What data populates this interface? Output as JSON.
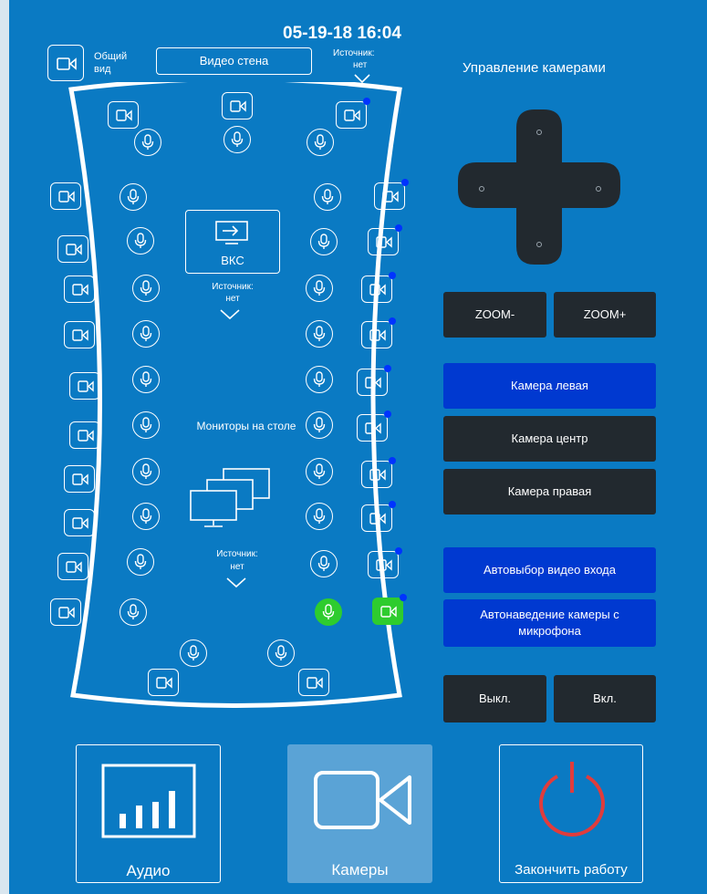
{
  "header": {
    "datetime": "05-19-18 16:04",
    "overview_label": "Общий вид",
    "video_wall_label": "Видео стена",
    "top_source_label": "Источник:",
    "top_source_value": "нет"
  },
  "room": {
    "vks_label": "ВКС",
    "vks_source_label": "Источник:",
    "vks_source_value": "нет",
    "monitors_label": "Мониторы на столе",
    "monitors_source_label": "Источник:",
    "monitors_source_value": "нет",
    "active_color": "#2ecc2e"
  },
  "camera_control": {
    "title": "Управление камерами",
    "zoom_out": "ZOOM-",
    "zoom_in": "ZOOM+",
    "cameras": [
      {
        "label": "Камера левая",
        "selected": true
      },
      {
        "label": "Камера центр",
        "selected": false
      },
      {
        "label": "Камера правая",
        "selected": false
      }
    ],
    "auto_input": "Автовыбор видео входа",
    "auto_aim": "Автонаведение камеры с микрофона",
    "off": "Выкл.",
    "on": "Вкл."
  },
  "bottom_nav": {
    "audio": "Аудио",
    "cameras": "Камеры",
    "finish": "Закончить работу",
    "power_color": "#e03c3c"
  }
}
